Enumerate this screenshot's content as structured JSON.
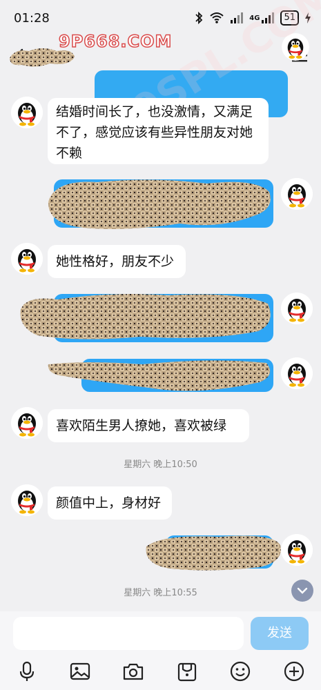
{
  "status_bar": {
    "time": "01:28",
    "battery": "51",
    "network": "4G"
  },
  "watermarks": {
    "site": "9P668.COM",
    "diagonal": "S19SPL.COM"
  },
  "messages": {
    "m1": "结婚时间长了，也没激情，又满足不了，感觉应该有些异性朋友对她不赖",
    "m2": "她性格好，朋友不少",
    "m3": "喜欢陌生男人撩她，喜欢被绿",
    "m4": "颜值中上，身材好"
  },
  "timestamps": {
    "t1": "星期六 晚上10:50",
    "t2": "星期六 晚上10:55"
  },
  "input": {
    "send_label": "发送",
    "placeholder": ""
  },
  "colors": {
    "bubble_blue": "#2ea6f5",
    "send_disabled": "#8dcaf5",
    "watermark_red": "#d94a4a"
  },
  "icons": [
    "back-icon",
    "menu-icon",
    "mic-icon",
    "image-icon",
    "camera-icon",
    "wallet-icon",
    "emoji-icon",
    "plus-icon",
    "chevron-down-icon",
    "penguin-avatar-icon"
  ]
}
